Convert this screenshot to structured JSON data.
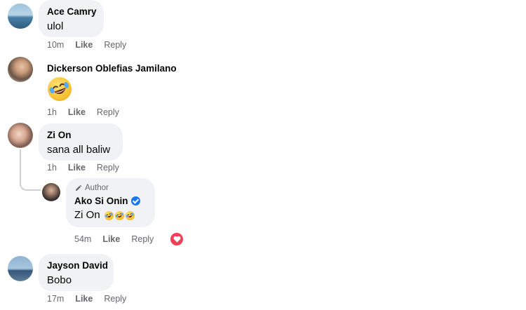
{
  "comments": [
    {
      "name": "Ace Camry",
      "text": "ulol",
      "time": "10m",
      "like": "Like",
      "reply": "Reply"
    },
    {
      "name": "Dickerson Oblefias Jamilano",
      "emoji": "rolling-on-floor-laughing",
      "time": "1h",
      "like": "Like",
      "reply": "Reply"
    },
    {
      "name": "Zi On",
      "text": "sana all baliw",
      "time": "1h",
      "like": "Like",
      "reply": "Reply",
      "replies": [
        {
          "badge": "Author",
          "name": "Ako Si Onin",
          "verified": true,
          "text": "Zi On",
          "emoji_count": 3,
          "time": "54m",
          "like": "Like",
          "reply": "Reply",
          "reaction": "heart"
        }
      ]
    },
    {
      "name": "Jayson David",
      "text": "Bobo",
      "time": "17m",
      "like": "Like",
      "reply": "Reply"
    }
  ],
  "colors": {
    "bubble": "#f0f2f5",
    "meta": "#65676b",
    "verified": "#1877f2",
    "heart": "#f33e58"
  }
}
